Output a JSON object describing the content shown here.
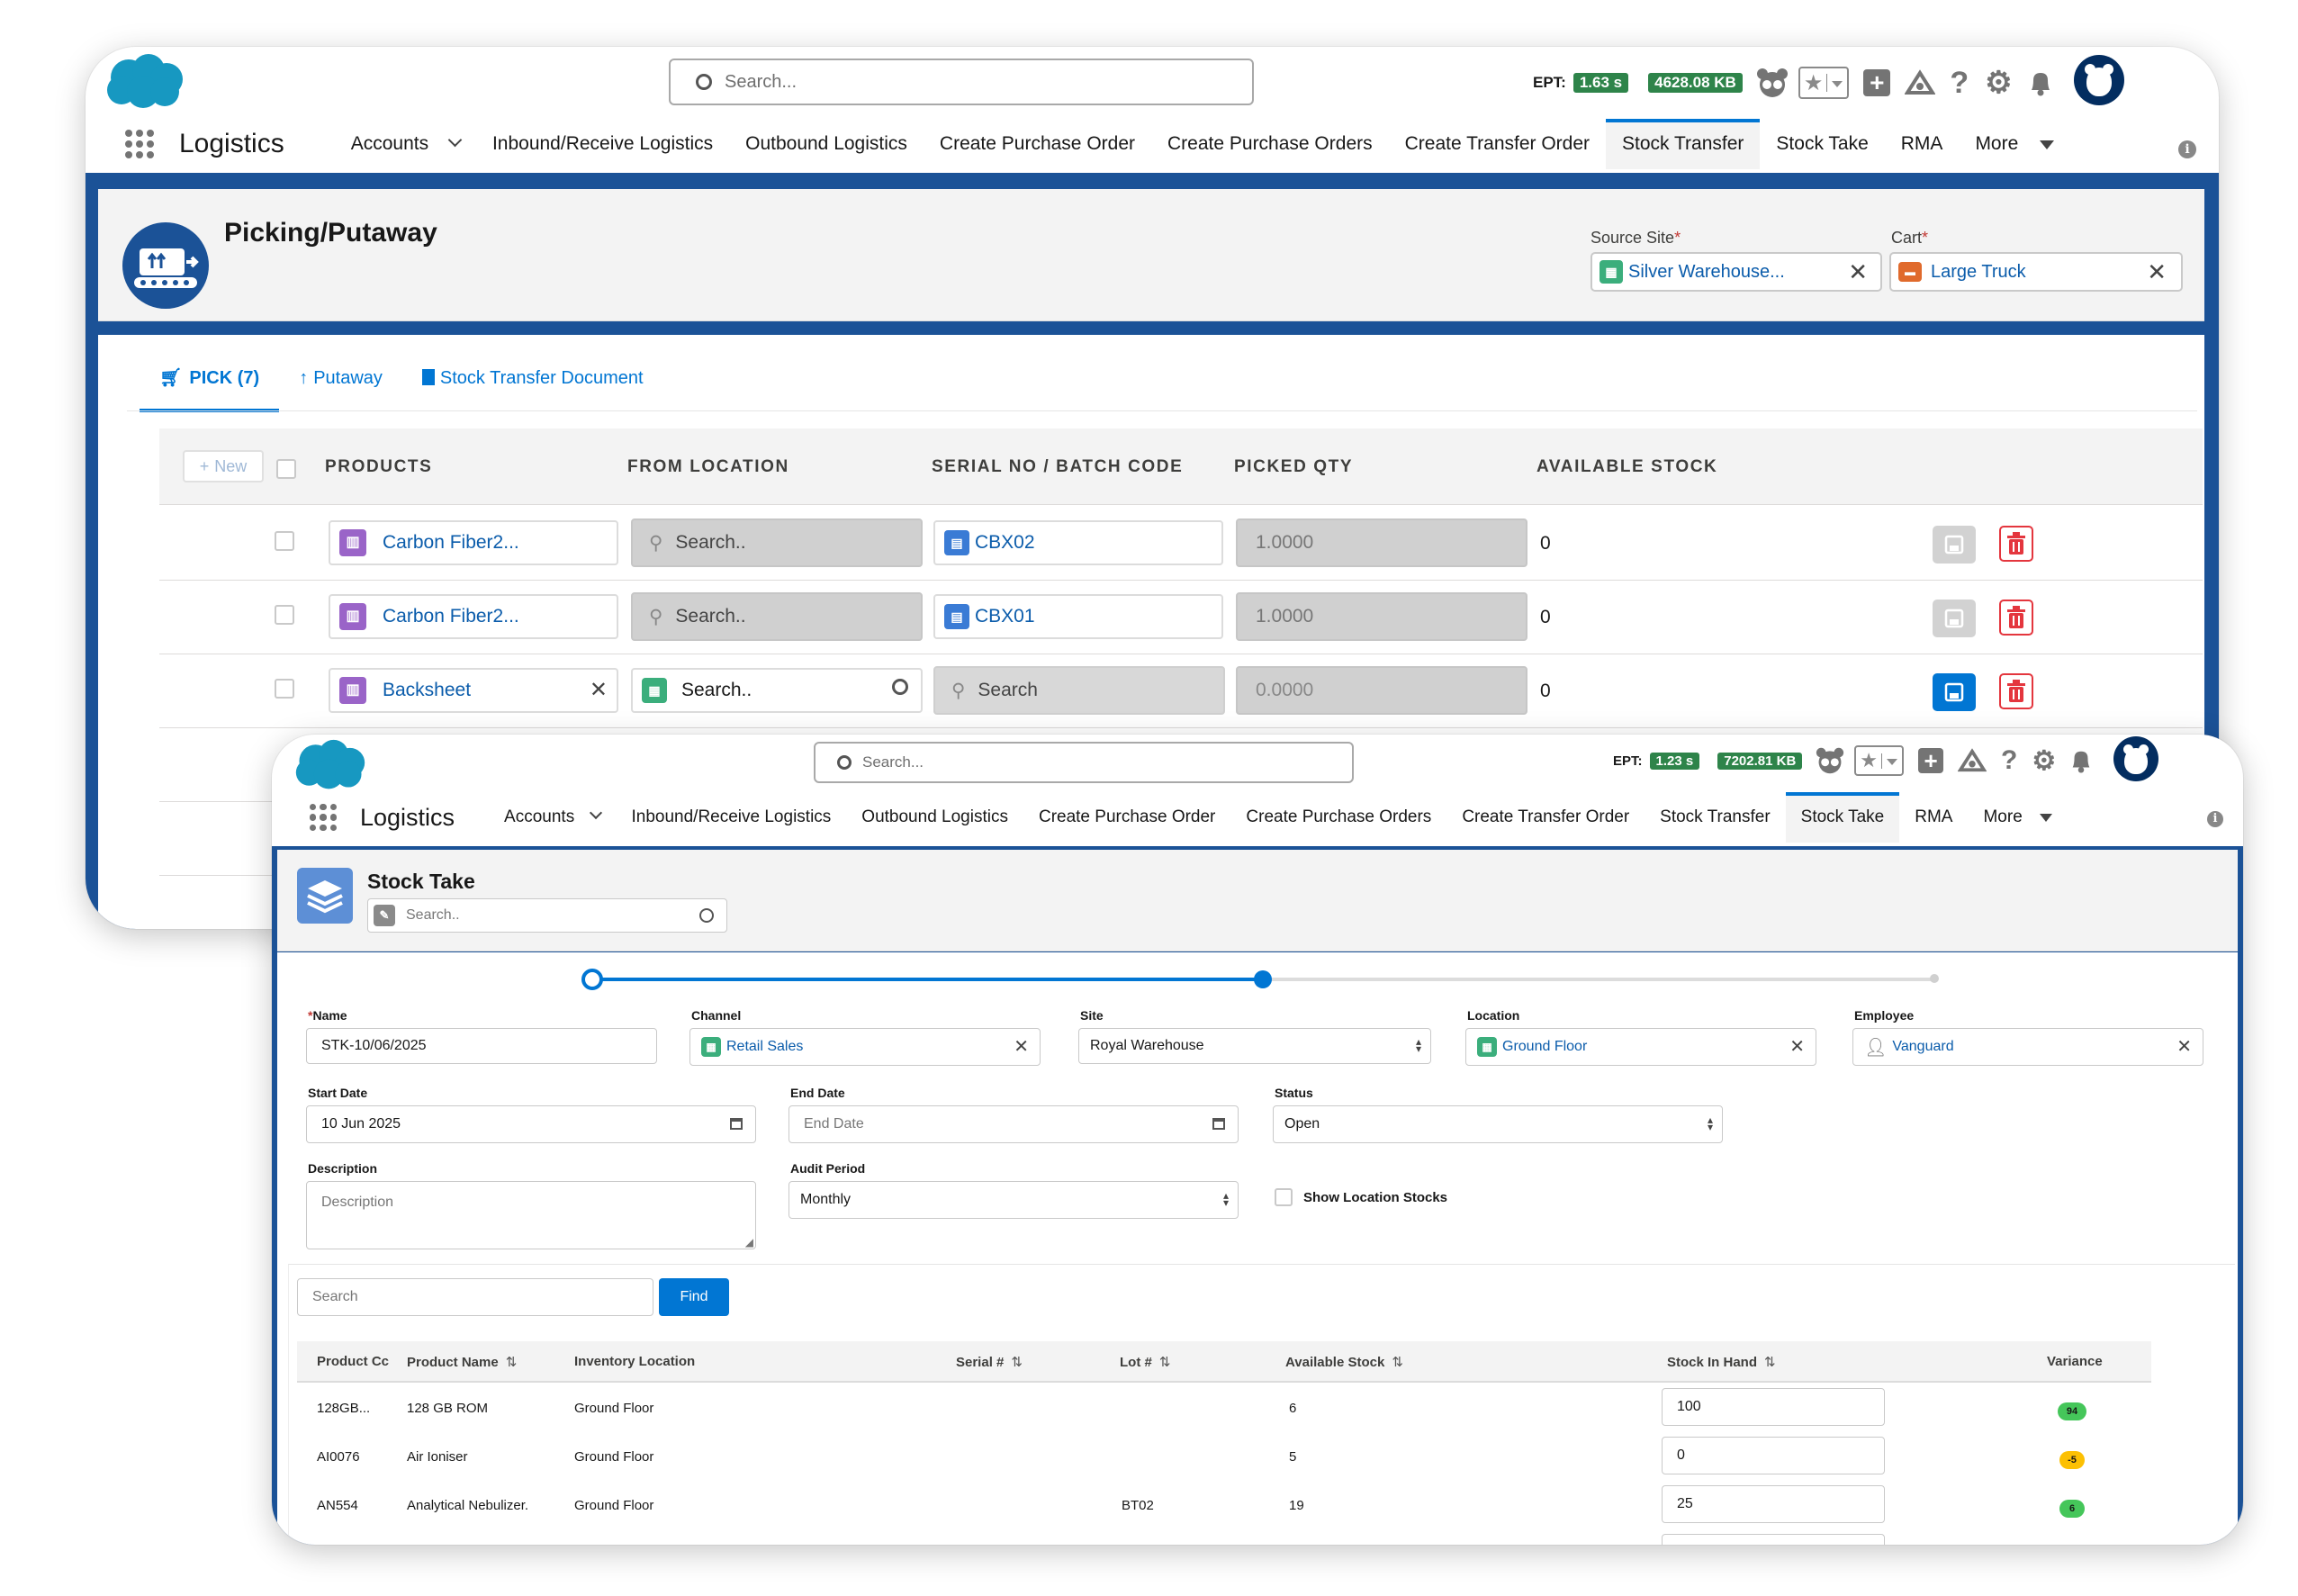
{
  "back": {
    "search_placeholder": "Search...",
    "ept_label": "EPT:",
    "ept_time": "1.63 s",
    "ept_mem": "4628.08 KB",
    "app_name": "Logistics",
    "nav": [
      "Accounts",
      "Inbound/Receive Logistics",
      "Outbound Logistics",
      "Create Purchase Order",
      "Create Purchase Orders",
      "Create Transfer Order",
      "Stock Transfer",
      "Stock Take",
      "RMA",
      "More"
    ],
    "active_nav": "Stock Transfer",
    "page_title": "Picking/Putaway",
    "source_site_label": "Source Site",
    "source_site_value": "Silver Warehouse...",
    "cart_label": "Cart",
    "cart_value": "Large Truck",
    "tabs": [
      "PICK (7)",
      "Putaway",
      "Stock Transfer Document"
    ],
    "new_button": "New",
    "columns": [
      "PRODUCTS",
      "FROM LOCATION",
      "SERIAL NO / BATCH CODE",
      "PICKED QTY",
      "AVAILABLE STOCK"
    ],
    "rows": [
      {
        "product": "Carbon Fiber2...",
        "from_location": "Search..",
        "serial": "CBX02",
        "picked_qty": "1.0000",
        "available": "0"
      },
      {
        "product": "Carbon Fiber2...",
        "from_location": "Search..",
        "serial": "CBX01",
        "picked_qty": "1.0000",
        "available": "0"
      },
      {
        "product": "Backsheet",
        "from_location": "Search..",
        "serial": "Search",
        "picked_qty": "0.0000",
        "available": "0"
      }
    ]
  },
  "front": {
    "search_placeholder": "Search...",
    "ept_label": "EPT:",
    "ept_time": "1.23 s",
    "ept_mem": "7202.81 KB",
    "app_name": "Logistics",
    "nav": [
      "Accounts",
      "Inbound/Receive Logistics",
      "Outbound Logistics",
      "Create Purchase Order",
      "Create Purchase Orders",
      "Create Transfer Order",
      "Stock Transfer",
      "Stock Take",
      "RMA",
      "More"
    ],
    "active_nav": "Stock Take",
    "page_title": "Stock Take",
    "title_search_placeholder": "Search..",
    "progress_fraction": 0.5,
    "form": {
      "name_label": "Name",
      "name_value": "STK-10/06/2025",
      "channel_label": "Channel",
      "channel_value": "Retail Sales",
      "site_label": "Site",
      "site_value": "Royal Warehouse",
      "location_label": "Location",
      "location_value": "Ground Floor",
      "employee_label": "Employee",
      "employee_value": "Vanguard",
      "start_date_label": "Start Date",
      "start_date_value": "10 Jun 2025",
      "end_date_label": "End Date",
      "end_date_placeholder": "End Date",
      "status_label": "Status",
      "status_value": "Open",
      "description_label": "Description",
      "description_placeholder": "Description",
      "audit_period_label": "Audit Period",
      "audit_period_value": "Monthly",
      "show_location_stocks": "Show Location Stocks"
    },
    "table_search_placeholder": "Search",
    "find_button": "Find",
    "columns": [
      "Product Cc",
      "Product Name",
      "Inventory Location",
      "Serial #",
      "Lot #",
      "Available Stock",
      "Stock In Hand",
      "Variance"
    ],
    "rows": [
      {
        "code": "128GB...",
        "name": "128 GB ROM",
        "location": "Ground Floor",
        "serial": "",
        "lot": "",
        "available": "6",
        "in_hand": "100",
        "variance": "94",
        "variance_color": "#45c65a"
      },
      {
        "code": "AI0076",
        "name": "Air Ioniser",
        "location": "Ground Floor",
        "serial": "",
        "lot": "",
        "available": "5",
        "in_hand": "0",
        "variance": "-5",
        "variance_color": "#fcc003"
      },
      {
        "code": "AN554",
        "name": "Analytical Nebulizer.",
        "location": "Ground Floor",
        "serial": "",
        "lot": "BT02",
        "available": "19",
        "in_hand": "25",
        "variance": "6",
        "variance_color": "#45c65a"
      }
    ]
  },
  "colors": {
    "brand_blue": "#0176d3",
    "band_blue": "#1b5297",
    "ept_green": "#2e844a",
    "delete_red": "#e4363e",
    "product_purple": "#9a64c8",
    "location_green": "#3bae7c"
  }
}
